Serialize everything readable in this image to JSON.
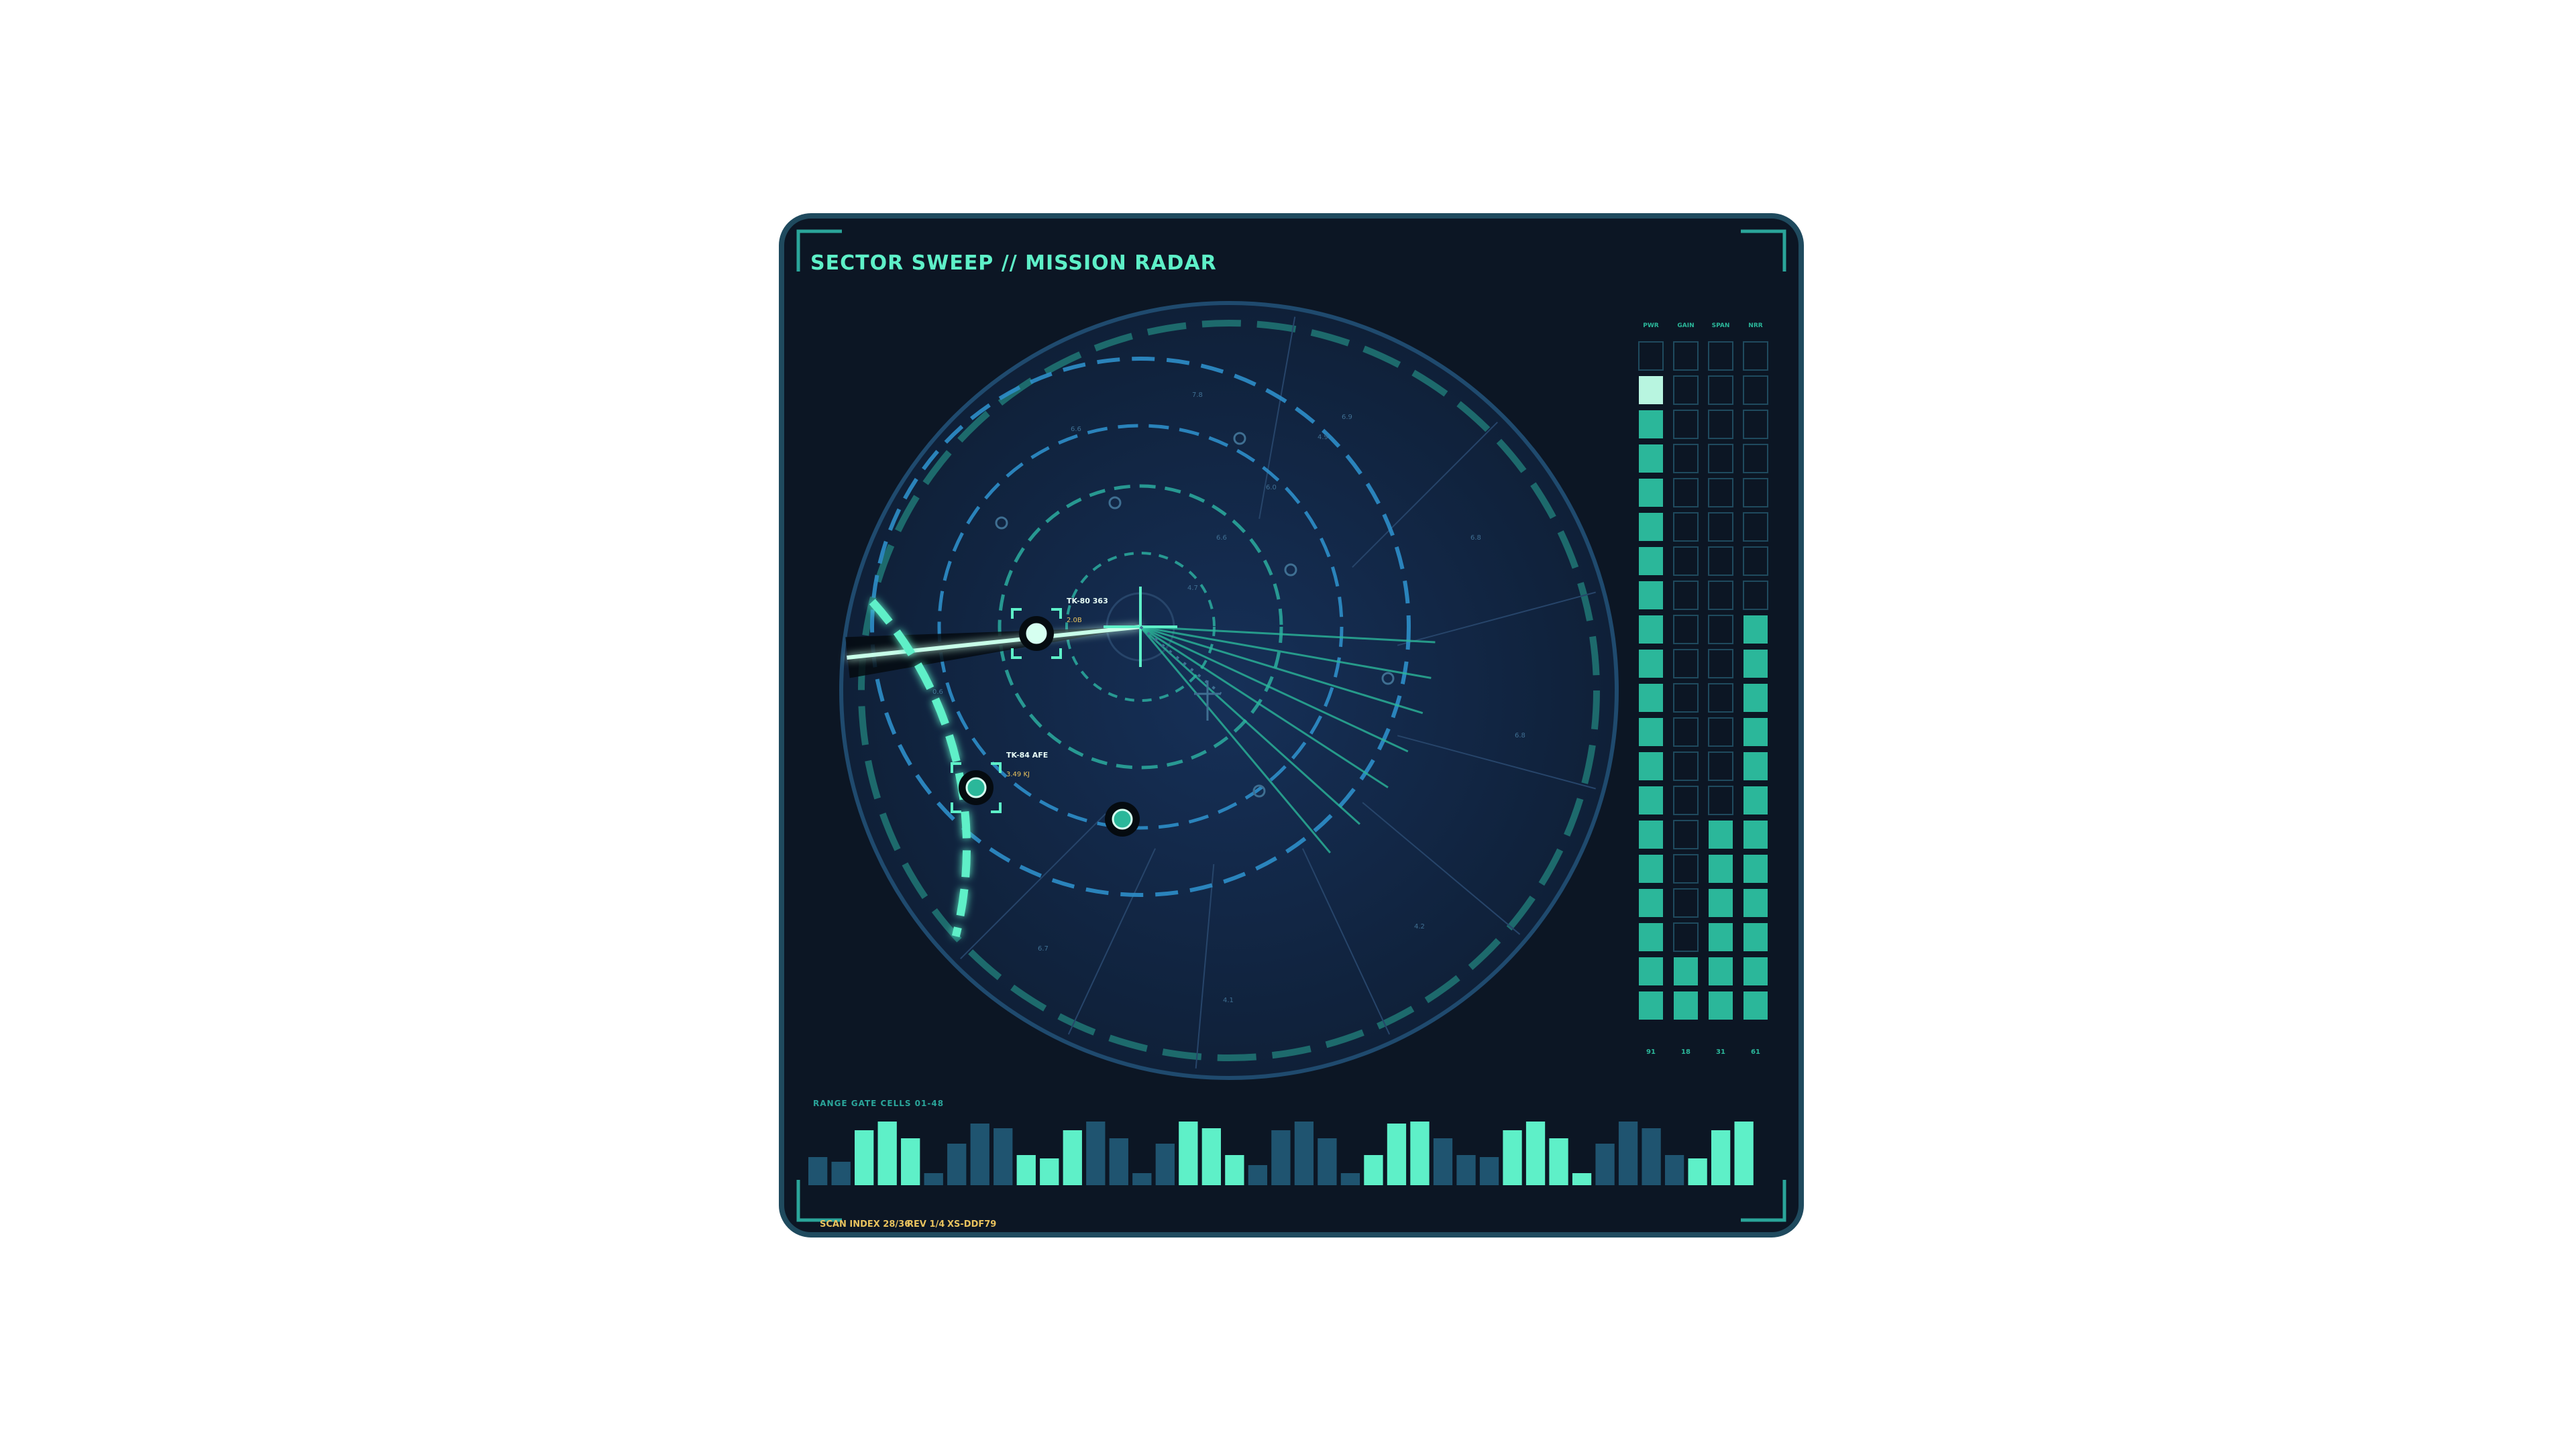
{
  "header": {
    "title": "SECTOR SWEEP // MISSION RADAR"
  },
  "colors": {
    "frame_bg": "#0c1624",
    "frame_border": "#1f4a5e",
    "radar_bg": "#112340",
    "accent": "#5ef0c8",
    "accent_dim": "#2bb79a",
    "ring_blue": "#2e8ec9",
    "ring_teal": "#2aa59a",
    "amber": "#e8c25e",
    "bar_dark": "#1f5470",
    "bar_bright": "#5ef0c8"
  },
  "radar": {
    "sweep_angle_deg": 186,
    "targets": [
      {
        "label": "TK-80 363",
        "sub": "2.0B",
        "has_reticle": true,
        "state": "locked"
      },
      {
        "label": "TK-84 AFE",
        "sub": "3.49 KJ",
        "has_reticle": true,
        "state": "tracked"
      },
      {
        "label": "",
        "sub": "",
        "has_reticle": false,
        "state": "contact"
      }
    ],
    "ring_labels": [
      "0.2",
      "0.4",
      "0.6",
      "0.8",
      "1.0"
    ],
    "spoke_labels": [
      "4.7",
      "6.6",
      "6.0",
      "4.9",
      "7.8",
      "6.6",
      "6.9",
      "6.8",
      "6.8",
      "4.2",
      "4.1",
      "6.7",
      "0.6"
    ]
  },
  "meters": {
    "columns": [
      {
        "label": "PWR",
        "value": 91,
        "level": 0.95
      },
      {
        "label": "GAIN",
        "value": 18,
        "level": 0.1
      },
      {
        "label": "SPAN",
        "value": 31,
        "level": 0.3
      },
      {
        "label": "NRR",
        "value": 61,
        "level": 0.575
      }
    ],
    "cells_per_column": 20
  },
  "histogram": {
    "label": "RANGE GATE CELLS 01-48",
    "values": [
      0.42,
      0.35,
      0.82,
      0.95,
      0.7,
      0.18,
      0.62,
      0.92,
      0.85,
      0.45,
      0.4,
      0.82,
      0.95,
      0.7,
      0.18,
      0.62,
      0.95,
      0.85,
      0.45,
      0.3,
      0.82,
      0.95,
      0.7,
      0.18,
      0.45,
      0.92,
      0.95,
      0.7,
      0.45,
      0.42,
      0.82,
      0.95,
      0.7,
      0.18,
      0.62,
      0.95,
      0.85,
      0.45,
      0.4,
      0.82,
      0.95
    ],
    "highlight": [
      false,
      false,
      true,
      true,
      true,
      false,
      false,
      false,
      false,
      true,
      true,
      true,
      false,
      false,
      false,
      false,
      true,
      true,
      true,
      false,
      false,
      false,
      false,
      false,
      true,
      true,
      true,
      false,
      false,
      false,
      true,
      true,
      true,
      true,
      false,
      false,
      false,
      false,
      true,
      true,
      true
    ]
  },
  "footer": {
    "scan_index": "SCAN INDEX 28/36",
    "rev": "REV 1/4",
    "code": "XS-DDF79"
  }
}
